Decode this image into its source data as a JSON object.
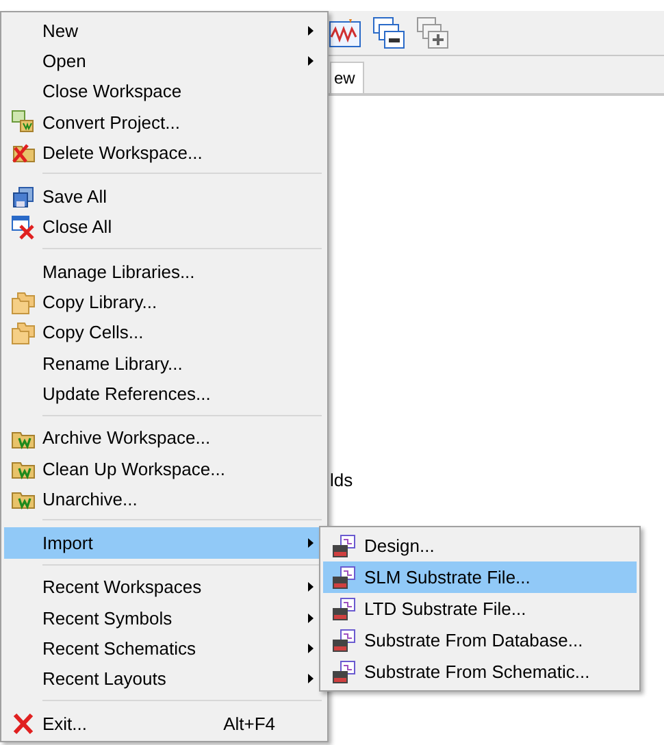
{
  "toolbar": {
    "tab": {
      "label": "ew",
      "selected": true
    }
  },
  "content": {
    "text": "lds"
  },
  "file_menu": {
    "items": [
      {
        "kind": "item",
        "label": "New",
        "has_submenu": true,
        "selected": false
      },
      {
        "kind": "item",
        "label": "Open",
        "has_submenu": true,
        "selected": false
      },
      {
        "kind": "item",
        "label": "Close Workspace",
        "has_submenu": false,
        "selected": false
      },
      {
        "kind": "item",
        "label": "Convert Project...",
        "has_submenu": false,
        "selected": false
      },
      {
        "kind": "item",
        "label": "Delete Workspace...",
        "has_submenu": false,
        "selected": false
      },
      {
        "kind": "separator"
      },
      {
        "kind": "item",
        "label": "Save All",
        "has_submenu": false,
        "selected": false
      },
      {
        "kind": "item",
        "label": "Close All",
        "has_submenu": false,
        "selected": false
      },
      {
        "kind": "separator"
      },
      {
        "kind": "item",
        "label": "Manage Libraries...",
        "has_submenu": false,
        "selected": false
      },
      {
        "kind": "item",
        "label": "Copy Library...",
        "has_submenu": false,
        "selected": false
      },
      {
        "kind": "item",
        "label": "Copy Cells...",
        "has_submenu": false,
        "selected": false
      },
      {
        "kind": "item",
        "label": "Rename Library...",
        "has_submenu": false,
        "selected": false
      },
      {
        "kind": "item",
        "label": "Update References...",
        "has_submenu": false,
        "selected": false
      },
      {
        "kind": "separator"
      },
      {
        "kind": "item",
        "label": "Archive Workspace...",
        "has_submenu": false,
        "selected": false
      },
      {
        "kind": "item",
        "label": "Clean Up Workspace...",
        "has_submenu": false,
        "selected": false
      },
      {
        "kind": "item",
        "label": "Unarchive...",
        "has_submenu": false,
        "selected": false
      },
      {
        "kind": "separator"
      },
      {
        "kind": "item",
        "label": "Import",
        "has_submenu": true,
        "selected": true
      },
      {
        "kind": "separator"
      },
      {
        "kind": "item",
        "label": "Recent Workspaces",
        "has_submenu": true,
        "selected": false
      },
      {
        "kind": "item",
        "label": "Recent Symbols",
        "has_submenu": true,
        "selected": false
      },
      {
        "kind": "item",
        "label": "Recent Schematics",
        "has_submenu": true,
        "selected": false
      },
      {
        "kind": "item",
        "label": "Recent Layouts",
        "has_submenu": true,
        "selected": false
      },
      {
        "kind": "separator"
      },
      {
        "kind": "item",
        "label": "Exit...",
        "shortcut": "Alt+F4",
        "has_submenu": false,
        "selected": false
      }
    ]
  },
  "import_submenu": {
    "items": [
      {
        "kind": "item",
        "label": "Design...",
        "selected": false
      },
      {
        "kind": "item",
        "label": "SLM Substrate File...",
        "selected": true
      },
      {
        "kind": "item",
        "label": "LTD Substrate File...",
        "selected": false
      },
      {
        "kind": "item",
        "label": "Substrate From Database...",
        "selected": false
      },
      {
        "kind": "item",
        "label": "Substrate From Schematic...",
        "selected": false
      }
    ]
  }
}
